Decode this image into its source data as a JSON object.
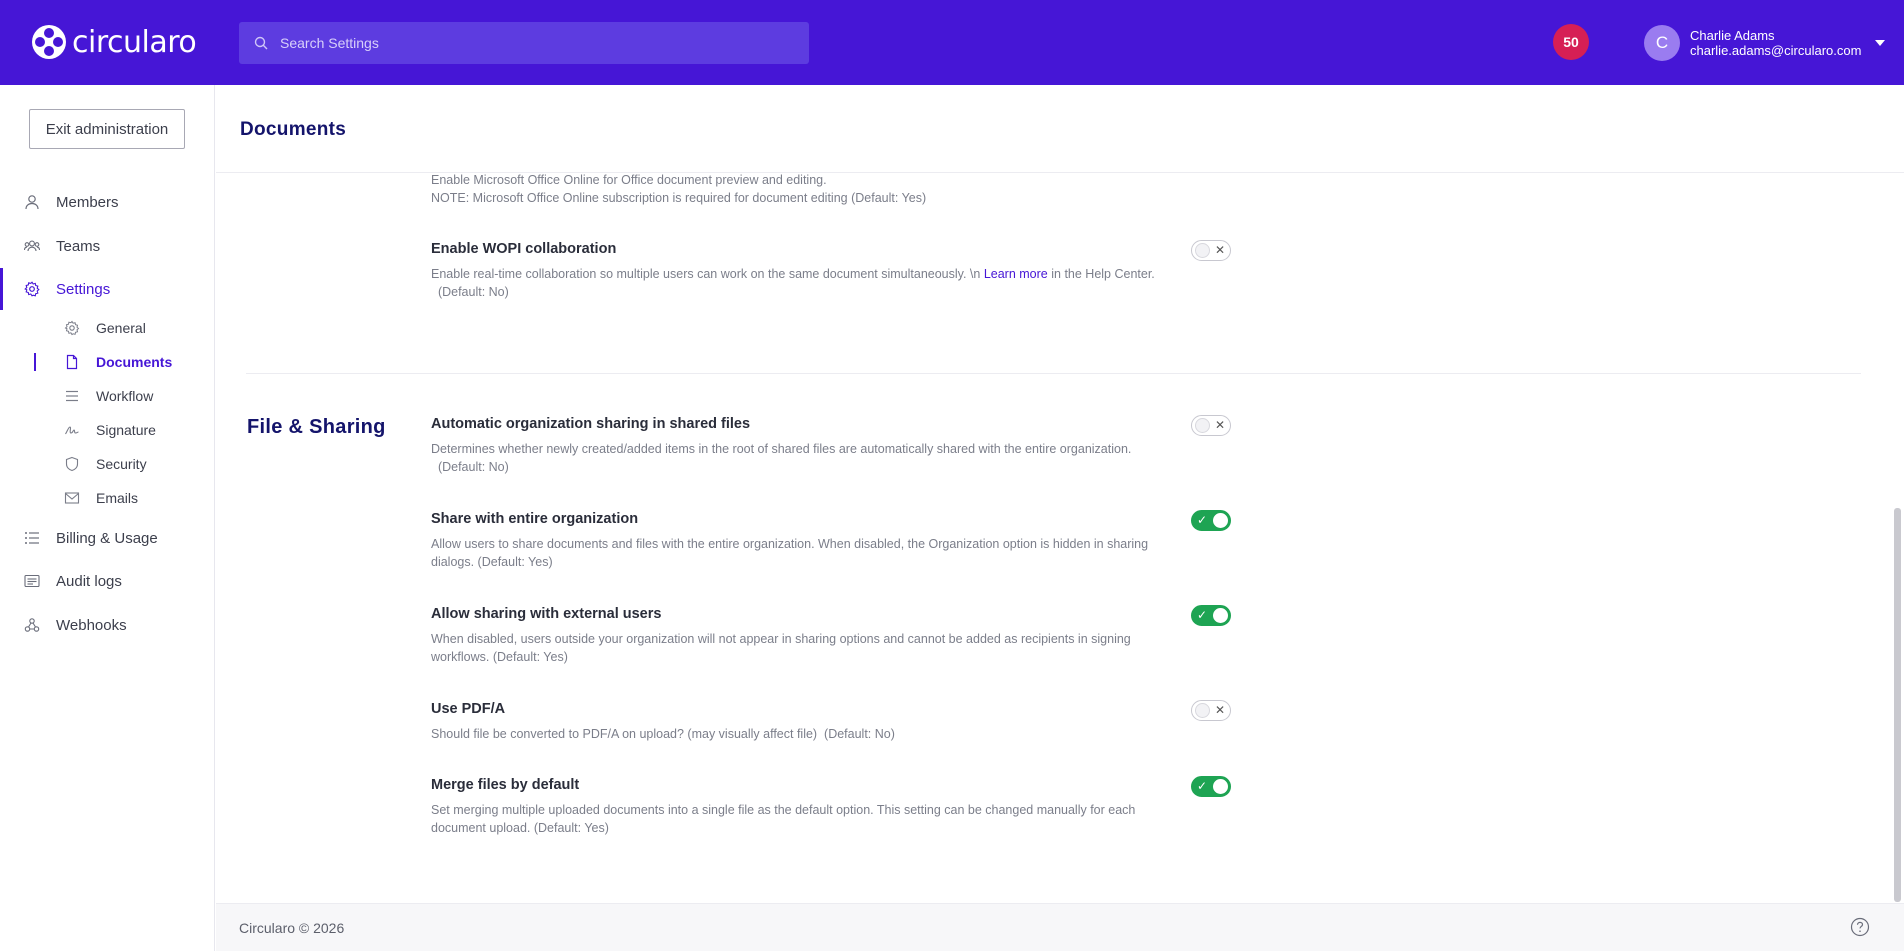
{
  "app": {
    "logo_text": "circularo"
  },
  "search": {
    "placeholder": "Search Settings"
  },
  "header": {
    "badge_count": "50",
    "user": {
      "initial": "C",
      "name": "Charlie Adams",
      "email": "charlie.adams@circularo.com"
    }
  },
  "sidebar": {
    "exit_label": "Exit administration",
    "items": {
      "members": "Members",
      "teams": "Teams",
      "settings": "Settings",
      "billing": "Billing & Usage",
      "audit": "Audit logs",
      "webhooks": "Webhooks"
    },
    "sub": {
      "general": "General",
      "documents": "Documents",
      "workflow": "Workflow",
      "signature": "Signature",
      "security": "Security",
      "emails": "Emails"
    }
  },
  "page": {
    "title": "Documents"
  },
  "settings": {
    "office_online": {
      "desc_line1": "Enable Microsoft Office Online for Office document preview and editing.",
      "desc_line2": "NOTE: Microsoft Office Online subscription is required for document editing  (Default: Yes)"
    },
    "wopi": {
      "title": "Enable WOPI collaboration",
      "desc_before": "Enable real-time collaboration so multiple users can work on the same document simultaneously. \\n ",
      "link": "Learn more",
      "desc_after": " in the Help Center.",
      "default": "  (Default: No)",
      "enabled": false
    }
  },
  "file_sharing": {
    "section_title": "File & Sharing",
    "items": [
      {
        "title": "Automatic organization sharing in shared files",
        "desc_line1": "Determines whether newly created/added items in the root of shared files are automatically shared with the entire organization.",
        "desc_line2": "  (Default: No)",
        "enabled": false
      },
      {
        "title": "Share with entire organization",
        "desc_line1": "Allow users to share documents and files with the entire organization. When disabled, the Organization option is hidden in sharing",
        "desc_line2": "dialogs.  (Default: Yes)",
        "enabled": true
      },
      {
        "title": "Allow sharing with external users",
        "desc_line1": "When disabled, users outside your organization will not appear in sharing options and cannot be added as recipients in signing",
        "desc_line2": "workflows.  (Default: Yes)",
        "enabled": true
      },
      {
        "title": "Use PDF/A",
        "desc_line1": "Should file be converted to PDF/A on upload? (may visually affect file)  (Default: No)",
        "desc_line2": "",
        "enabled": false
      },
      {
        "title": "Merge files by default",
        "desc_line1": "Set merging multiple uploaded documents into a single file as the default option. This setting can be changed manually for each",
        "desc_line2": "document upload.  (Default: Yes)",
        "enabled": true
      }
    ]
  },
  "toggle_marks": {
    "on": "✓",
    "off": "✕"
  },
  "footer": {
    "copyright": "Circularo © 2026"
  },
  "colors": {
    "brand": "#4616d6",
    "toggle_on": "#1ea453",
    "badge": "#d61f55"
  }
}
